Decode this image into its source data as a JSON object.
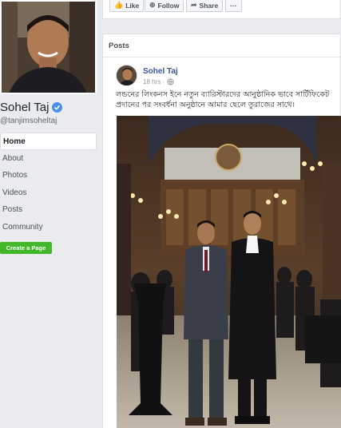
{
  "profile": {
    "name": "Sohel Taj",
    "handle": "@tanjimsoheltaj"
  },
  "nav": {
    "items": [
      {
        "label": "Home",
        "active": true
      },
      {
        "label": "About",
        "active": false
      },
      {
        "label": "Photos",
        "active": false
      },
      {
        "label": "Videos",
        "active": false
      },
      {
        "label": "Posts",
        "active": false
      },
      {
        "label": "Community",
        "active": false
      }
    ],
    "create_page_label": "Create a Page"
  },
  "actionbar": {
    "like_label": "Like",
    "follow_label": "Follow",
    "share_label": "Share",
    "more_label": "···"
  },
  "posts": {
    "header": "Posts",
    "post": {
      "author": "Sohel Taj",
      "time": "18 hrs ·",
      "text": "লন্ডনের লিংকনস ইনে নতুন ব্যারিস্টারদের আনুষ্ঠানিক ভাবে সার্টিফিকেট প্রদানের পর সংবর্ধনা অনুষ্ঠানে আমার ছেলে তুরাজের সাথে।"
    }
  },
  "colors": {
    "page_bg": "#e9ebee",
    "link_blue": "#385898",
    "create_green": "#42b72a",
    "verified_blue": "#4b8ef1"
  }
}
